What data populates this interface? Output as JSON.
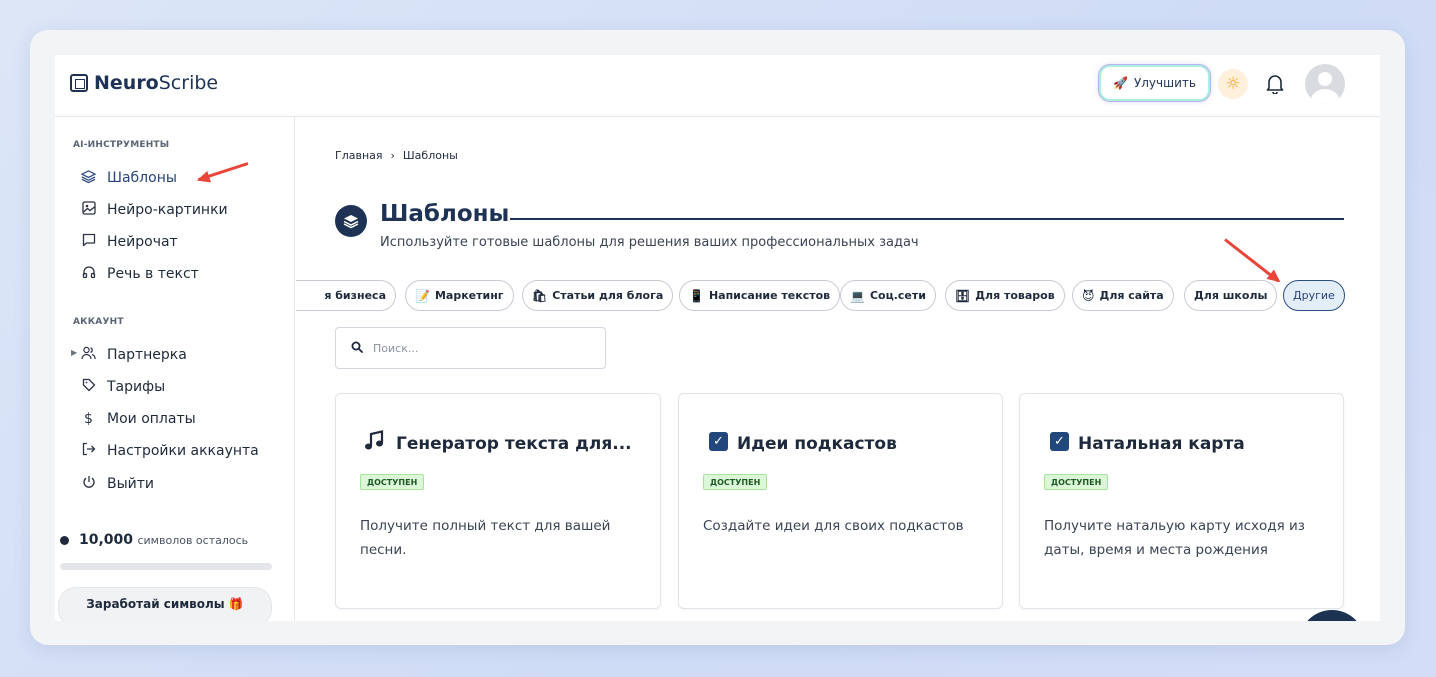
{
  "logo": {
    "bold": "Neuro",
    "rest": "Scribe"
  },
  "header": {
    "upgrade_label": "Улучшить"
  },
  "sidebar": {
    "section_tools": "AI-ИНСТРУМЕНТЫ",
    "tools": [
      {
        "label": "Шаблоны",
        "icon": "layers-icon",
        "active": true
      },
      {
        "label": "Нейро-картинки",
        "icon": "image-icon"
      },
      {
        "label": "Нейрочат",
        "icon": "chat-icon"
      },
      {
        "label": "Речь в текст",
        "icon": "headphones-icon"
      }
    ],
    "section_account": "АККАУНТ",
    "account": [
      {
        "label": "Партнерка",
        "icon": "users-icon"
      },
      {
        "label": "Тарифы",
        "icon": "tag-icon"
      },
      {
        "label": "Мои оплаты",
        "icon": "dollar-icon"
      },
      {
        "label": "Настройки аккаунта",
        "icon": "logout-arrow-icon"
      },
      {
        "label": "Выйти",
        "icon": "power-icon"
      }
    ],
    "credits_value": "10,000",
    "credits_text": "символов осталось",
    "credits_progress": 1.0,
    "earn_label": "Заработай символы"
  },
  "main": {
    "breadcrumb_home": "Главная",
    "breadcrumb_sep": "›",
    "breadcrumb_current": "Шаблоны",
    "title": "Шаблоны",
    "subtitle": "Используйте готовые шаблоны для решения ваших профессиональных задач",
    "chips": [
      {
        "label": "я бизнеса",
        "emoji": ""
      },
      {
        "label": "Маркетинг",
        "emoji": "📝"
      },
      {
        "label": "Статьи для блога",
        "emoji": "🛍"
      },
      {
        "label": "Написание текстов",
        "emoji": "📱"
      },
      {
        "label": "Соц.сети",
        "emoji": "💻"
      },
      {
        "label": "Для товаров",
        "emoji": "🗄"
      },
      {
        "label": "Для сайта",
        "emoji": "😈"
      },
      {
        "label": "Для школы",
        "emoji": ""
      },
      {
        "label": "Другие",
        "emoji": "",
        "active": true
      }
    ],
    "search_placeholder": "Поиск...",
    "cards": [
      {
        "title": "Генератор текста для...",
        "badge": "ДОСТУПЕН",
        "desc1": "Получите полный текст для вашей",
        "desc2": "песни.",
        "icon": "music-note-icon"
      },
      {
        "title": "Идеи подкастов",
        "badge": "ДОСТУПЕН",
        "desc1": "Создайте идеи для своих подкастов",
        "desc2": "",
        "icon": "checkbox-icon"
      },
      {
        "title": "Натальная карта",
        "badge": "ДОСТУПЕН",
        "desc1": "Получите натальую карту исходя из",
        "desc2": "даты, время и места рождения",
        "icon": "checkbox-icon"
      }
    ]
  },
  "colors": {
    "brand": "#1e3354",
    "accent_arrow": "#e8453b",
    "badge_green": "#dcf7d7"
  }
}
